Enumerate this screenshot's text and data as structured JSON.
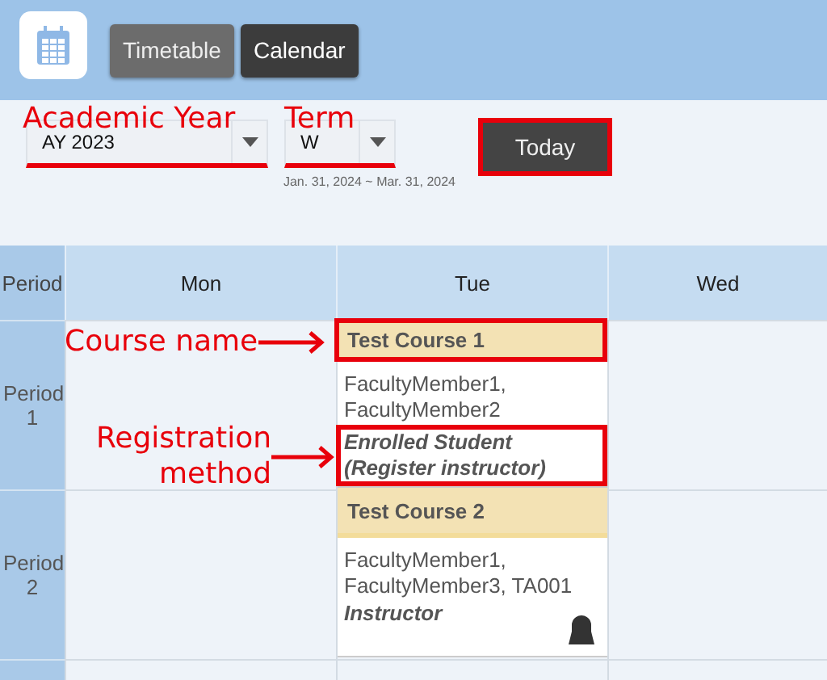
{
  "header": {
    "tabs": [
      {
        "label": "Timetable",
        "selected": true
      },
      {
        "label": "Calendar",
        "selected": false
      }
    ]
  },
  "filters": {
    "year": {
      "value": "AY 2023",
      "underlined": true
    },
    "term": {
      "value": "W",
      "underlined": true
    },
    "date_range": "Jan. 31, 2024 ~ Mar. 31, 2024",
    "today_button": {
      "label": "Today",
      "highlighted": true
    }
  },
  "timetable": {
    "columns": [
      "Period",
      "Mon",
      "Tue",
      "Wed"
    ],
    "rows": [
      {
        "period": "Period 1",
        "cells": [
          {
            "kind": "empty"
          },
          {
            "kind": "course",
            "name": "Test Course 1",
            "faculty": "FacultyMember1, FacultyMember2",
            "role": "Enrolled Student (Register instructor)",
            "highlighted": true,
            "instructor_icon": false
          },
          {
            "kind": "empty"
          }
        ]
      },
      {
        "period": "Period 2",
        "cells": [
          {
            "kind": "empty"
          },
          {
            "kind": "course",
            "name": "Test Course 2",
            "faculty": "FacultyMember1, FacultyMember3, TA001",
            "role": "Instructor",
            "highlighted": false,
            "instructor_icon": true
          },
          {
            "kind": "empty"
          }
        ]
      },
      {
        "period": "",
        "cells": [
          {
            "kind": "empty"
          },
          {
            "kind": "empty"
          },
          {
            "kind": "empty"
          }
        ]
      }
    ]
  },
  "annotations": [
    {
      "text": "Academic Year"
    },
    {
      "text": "Term"
    },
    {
      "text": "Course name"
    },
    {
      "text": "Registration method"
    }
  ]
}
